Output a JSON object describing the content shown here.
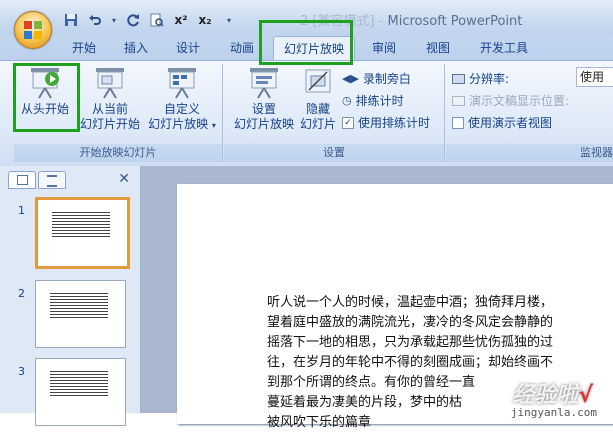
{
  "window": {
    "title_muted": "2 [兼容模式] - ",
    "title": "Microsoft PowerPoint"
  },
  "qat": {
    "save_icon": "save-icon",
    "undo_icon": "undo-icon",
    "redo_icon": "redo-icon",
    "preview_icon": "print-preview-icon",
    "superscript": "x²",
    "subscript": "x₂"
  },
  "tabs": [
    {
      "label": "开始"
    },
    {
      "label": "插入"
    },
    {
      "label": "设计"
    },
    {
      "label": "动画"
    },
    {
      "label": "幻灯片放映",
      "active": true
    },
    {
      "label": "审阅"
    },
    {
      "label": "视图"
    },
    {
      "label": "开发工具"
    }
  ],
  "ribbon": {
    "group_start": {
      "label": "开始放映幻灯片",
      "from_beginning": "从头开始",
      "from_current_1": "从当前",
      "from_current_2": "幻灯片开始",
      "custom_1": "自定义",
      "custom_2": "幻灯片放映"
    },
    "group_setup": {
      "label": "设置",
      "setup_1": "设置",
      "setup_2": "幻灯片放映",
      "hide_1": "隐藏",
      "hide_2": "幻灯片",
      "record_narration": "录制旁白",
      "rehearse_timings": "排练计时",
      "use_rehearsed_timings": "使用排练计时",
      "use_rehearsed_checked": true
    },
    "group_monitors": {
      "label": "监视器",
      "resolution": "分辨率:",
      "resolution_value": "使用",
      "show_presentation_on": "演示文稿显示位置:",
      "presenter_view": "使用演示者视图"
    }
  },
  "thumbnails": [
    {
      "num": "1",
      "selected": true
    },
    {
      "num": "2",
      "selected": false
    },
    {
      "num": "3",
      "selected": false
    }
  ],
  "slide_text": [
    "听人说一个人的时候，温起壶中酒；独倚拜月楼，",
    "望着庭中盛放的满院流光，凄冷的冬风定会静静的",
    "摇落下一地的相思，只为承载起那些忧伤孤独的过",
    "往，在岁月的年轮中不得的刻圈成画；却始终画不",
    "到那个所谓的终点。有你的曾经一直",
    "蔓延着最为凄美的片段，梦中的枯",
    "被风吹下乐的篇章"
  ],
  "watermark": {
    "text": "经验啦",
    "check": "√",
    "sub": "jingyanla.com"
  },
  "colors": {
    "highlight": "#1ea11e",
    "selected_thumb": "#e39a3f"
  }
}
